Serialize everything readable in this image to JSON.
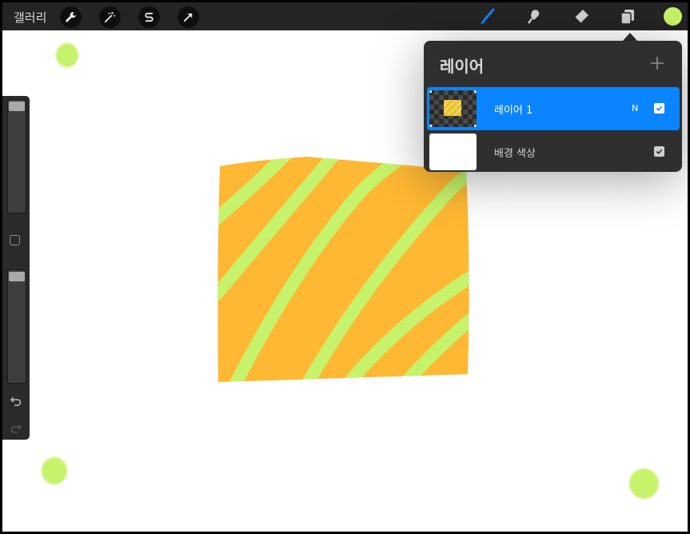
{
  "topbar": {
    "gallery_label": "갤러리",
    "tools_left": [
      {
        "icon": "wrench-icon",
        "name": "actions"
      },
      {
        "icon": "magic-wand-icon",
        "name": "adjustments"
      },
      {
        "icon": "selection-s-icon",
        "name": "selection"
      },
      {
        "icon": "transform-arrow-icon",
        "name": "transform"
      }
    ],
    "tools_right": [
      {
        "icon": "brush-icon",
        "name": "paint",
        "active": true
      },
      {
        "icon": "smudge-icon",
        "name": "smudge",
        "active": false
      },
      {
        "icon": "eraser-icon",
        "name": "eraser",
        "active": false
      },
      {
        "icon": "layers-icon",
        "name": "layers",
        "active": false
      }
    ],
    "current_color": "#c6f36b"
  },
  "layers_panel": {
    "title": "레이어",
    "add_icon": "plus-icon",
    "layers": [
      {
        "name": "레이어 1",
        "blend_mode": "N",
        "visible": true,
        "selected": true
      },
      {
        "name": "배경 색상",
        "visible": true,
        "selected": false
      }
    ]
  },
  "sidebar": {
    "brush_size_level": 1.0,
    "opacity_level": 1.0,
    "undo_icon": "undo-icon",
    "redo_icon": "redo-icon"
  },
  "colors": {
    "accent": "#0a84ff",
    "toolbar": "#242424",
    "panel": "#2f2f2f",
    "artwork_orange": "#ffb833",
    "artwork_green": "#c6f36b"
  }
}
